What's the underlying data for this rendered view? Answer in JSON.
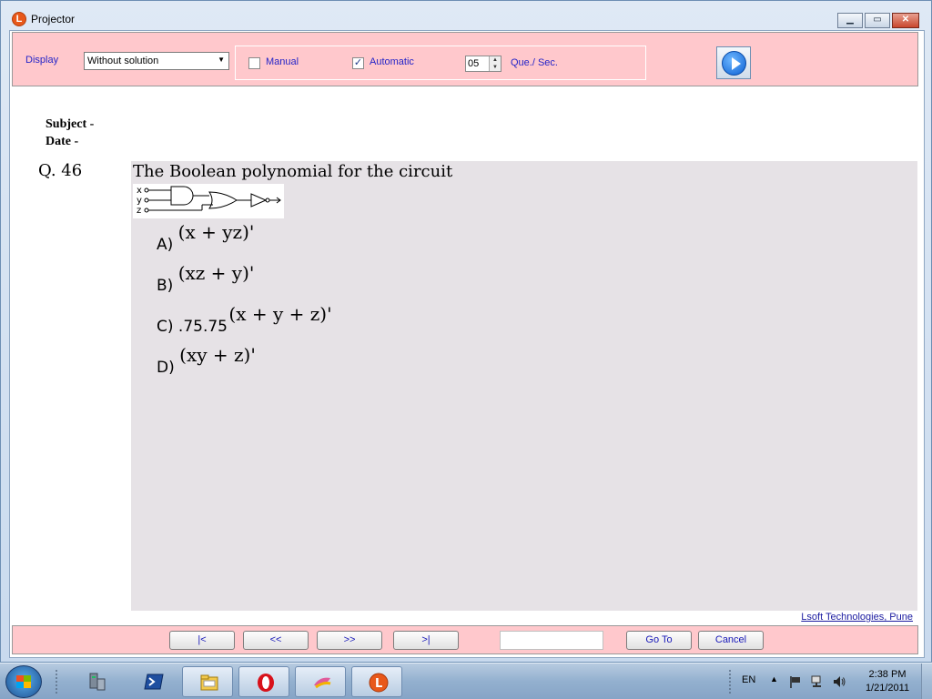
{
  "window": {
    "title": "Projector",
    "app_icon_letter": "L"
  },
  "toolbar": {
    "display_label": "Display",
    "display_value": "Without solution",
    "manual_label": "Manual",
    "manual_checked": false,
    "automatic_label": "Automatic",
    "automatic_checked": true,
    "rate_value": "05",
    "rate_label": "Que./ Sec."
  },
  "header": {
    "subject": "Subject -",
    "date": "Date -"
  },
  "question": {
    "number": "Q. 46",
    "text": "The Boolean polynomial for the circuit",
    "circuit_inputs": [
      "x",
      "y",
      "z"
    ],
    "options": [
      {
        "label": "A)",
        "prefix": "",
        "expr": "(x + yz)'"
      },
      {
        "label": "B)",
        "prefix": "",
        "expr": "(xz + y)'"
      },
      {
        "label": "C)",
        "prefix": ".75.75",
        "expr": "(x + y + z)'"
      },
      {
        "label": "D)",
        "prefix": "",
        "expr": "(xy + z)'"
      }
    ]
  },
  "credit": "Lsoft Technologies, Pune",
  "nav": {
    "first": "|<",
    "prev": "<<",
    "next": ">>",
    "last": ">|",
    "goto_value": "",
    "goto": "Go To",
    "cancel": "Cancel"
  },
  "taskbar": {
    "language": "EN",
    "time": "2:38 PM",
    "date": "1/21/2011",
    "pinned": [
      "server-manager",
      "powershell",
      "explorer",
      "opera",
      "visual-studio",
      "lsoft-projector"
    ]
  },
  "colors": {
    "panel_pink": "#ffc8cc",
    "question_bg": "#e6e2e6",
    "label_blue": "#2424c8"
  }
}
